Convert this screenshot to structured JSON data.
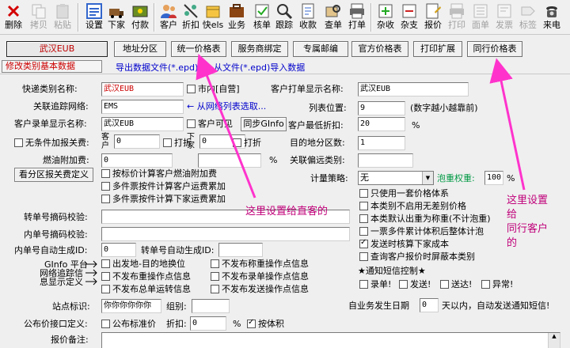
{
  "toolbar": {
    "items": [
      {
        "label": "删除",
        "icon": "delete-icon"
      },
      {
        "label": "拷贝",
        "icon": "copy-icon",
        "disabled": true
      },
      {
        "label": "粘贴",
        "icon": "paste-icon",
        "disabled": true
      },
      {
        "label": "设置",
        "icon": "settings-icon"
      },
      {
        "label": "下家",
        "icon": "downstream-icon"
      },
      {
        "label": "付款",
        "icon": "payment-icon"
      },
      {
        "label": "客户",
        "icon": "customer-icon"
      },
      {
        "label": "折扣",
        "icon": "discount-icon"
      },
      {
        "label": "快els",
        "icon": "express-icon"
      },
      {
        "label": "业务",
        "icon": "business-icon"
      },
      {
        "label": "核单",
        "icon": "verify-icon"
      },
      {
        "label": "跟踪",
        "icon": "tracking-icon"
      },
      {
        "label": "收款",
        "icon": "receipt-icon"
      },
      {
        "label": "查单",
        "icon": "search-order-icon"
      },
      {
        "label": "打单",
        "icon": "print-order-icon"
      },
      {
        "label": "杂收",
        "icon": "misc-income-icon"
      },
      {
        "label": "杂支",
        "icon": "misc-expense-icon"
      },
      {
        "label": "报价",
        "icon": "quote-icon"
      },
      {
        "label": "打印",
        "icon": "print-icon",
        "disabled": true
      },
      {
        "label": "面单",
        "icon": "waybill-icon",
        "disabled": true
      },
      {
        "label": "发票",
        "icon": "invoice-icon",
        "disabled": true
      },
      {
        "label": "标签",
        "icon": "label-icon",
        "disabled": true
      },
      {
        "label": "来电",
        "icon": "phone-icon"
      }
    ]
  },
  "tabs": [
    "武汉EUB",
    "地址分区",
    "统一价格表",
    "服务商绑定",
    "专属邮编",
    "官方价格表",
    "打印扩展",
    "同行价格表"
  ],
  "sublinks": {
    "modify": "修改类别基本数据",
    "export": "导出数据文件(*.epd)",
    "import": "从文件(*.epd)导入数据"
  },
  "form": {
    "category_name_label": "快递类别名称:",
    "category_name_value": "武汉EUB",
    "city_label": "市内[自营]",
    "customer_print_name_label": "客户打单显示名称:",
    "customer_print_name_value": "武汉EUB",
    "tracking_network_label": "关联追踪网络:",
    "tracking_network_value": "EMS",
    "tracking_hint": "← 从网络列表选取...",
    "list_position_label": "列表位置:",
    "list_position_value": "9",
    "list_position_hint": "(数字越小越靠前)",
    "customer_entry_name_label": "客户录单显示名称:",
    "customer_entry_name_value": "武汉EUB",
    "customer_visible_label": "客户可见",
    "sync_ginfo_label": "同步GInfo",
    "min_discount_label": "客户最低折扣:",
    "min_discount_value": "20",
    "percent": "%",
    "unconditional_fee_label": "无条件加报关费:",
    "customer_side_label": "客户",
    "downstream_side_label": "下家",
    "fee_customer_value": "0",
    "fee_downstream_value": "0",
    "discount_label": "打折",
    "destination_zones_label": "目的地分区数:",
    "destination_zones_value": "1",
    "fuel_surcharge_label": "燃油附加费:",
    "fuel_surcharge_value": "0",
    "remote_category_label": "关联偏远类别:",
    "remote_category_value": "",
    "view_zone_button": "看分区报关费定义",
    "check_fuel_customer": "按标价计算客户燃油附加费",
    "check_multi_customer": "多件票按件计算客户运费累加",
    "check_multi_downstream": "多件票按件计算下家运费累加",
    "pricing_strategy_label": "计量策略:",
    "pricing_strategy_value": "无",
    "bubble_weight_label": "泡重权重:",
    "bubble_weight_value": "100",
    "check_single_price": "只使用一套价格体系",
    "check_no_remote": "本类别不启用无差别价格",
    "check_default_weight": "本类默认出重为称重(不计泡重)",
    "check_accumulate": "一票多件累计体积后整体计泡",
    "check_verify_cost": "发送时核算下家成本",
    "check_hide_category": "查询客户报价时屏蔽本类别",
    "waybill_validation_label": "转单号摘码校验:",
    "internal_validation_label": "内单号摘码校验:",
    "internal_autogen_label": "内单号自动生成ID:",
    "internal_autogen_value": "0",
    "transfer_autogen_label": "转单号自动生成ID:",
    "transfer_autogen_value": "",
    "sms_notice_label": "★通知短信控制★",
    "sms_record": "录单!",
    "sms_send": "发送!",
    "sms_delivered": "送达!",
    "sms_exception": "异常!",
    "ginfo_platform_label": "GInfo 平台",
    "network_tracking_label": "网络追踪信",
    "definition_label": "息显示定义",
    "check_origin_scan": "出发地-目的地换位",
    "check_no_return_ops": "不发布重操作点信息",
    "check_no_total": "不发布总单运转信息",
    "check_no_scan_ops": "不发布称重操作点信息",
    "check_no_entry_ops": "不发布录单操作点信息",
    "check_no_send_ops": "不发布发送操作点信息",
    "station_label": "站点标识:",
    "station_value": "你你你你你你",
    "group_label": "组别:",
    "group_value": "",
    "business_date_label": "自业务发生日期",
    "business_date_value": "0",
    "business_date_hint": "天以内，自动发送通知短信!",
    "public_price_label": "公布价接口定义:",
    "public_standard_label": "公布标准价",
    "public_discount_label": "折扣:",
    "public_discount_value": "0",
    "by_volume_label": "按体积",
    "remark_label": "报价备注:"
  },
  "annotations": {
    "direct_customer": "这里设置给直客的",
    "peer_line1": "这里设置",
    "peer_line2": "给",
    "peer_line3": "同行客户",
    "peer_line4": "的"
  },
  "colors": {
    "annotation": "#c0007a",
    "arrow": "#ff33cc",
    "link_blue": "#0000cc",
    "link_red": "#cc0000"
  }
}
